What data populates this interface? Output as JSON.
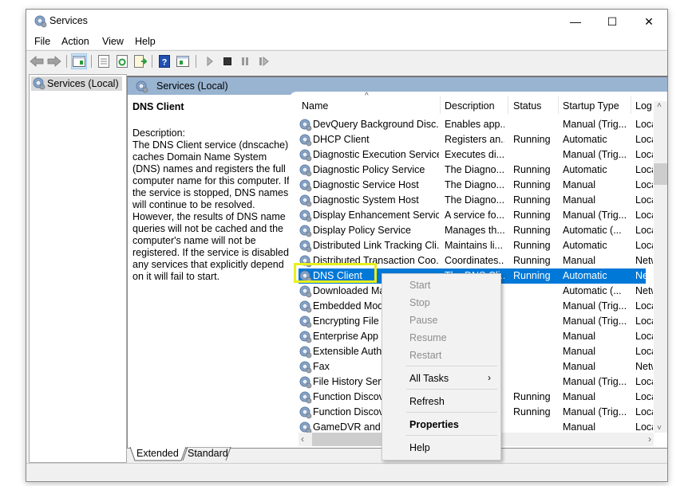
{
  "window": {
    "title": "Services",
    "controls": {
      "minimize": "—",
      "maximize": "☐",
      "close": "✕"
    }
  },
  "menubar": {
    "items": [
      "File",
      "Action",
      "View",
      "Help"
    ]
  },
  "toolbar": {
    "buttons": [
      "back-icon",
      "forward-icon",
      "show-hide-console-tree-icon",
      "properties-icon",
      "refresh-icon",
      "export-list-icon",
      "help-icon",
      "show-action-pane-icon",
      "start-service-icon",
      "stop-service-icon",
      "pause-service-icon",
      "restart-service-icon"
    ]
  },
  "tree": {
    "root": "Services (Local)"
  },
  "panel": {
    "header": "Services (Local)",
    "selected_service": {
      "name": "DNS Client",
      "description_label": "Description:",
      "description": "The DNS Client service (dnscache) caches Domain Name System (DNS) names and registers the full computer name for this computer. If the service is stopped, DNS names will continue to be resolved. However, the results of DNS name queries will not be cached and the computer's name will not be registered. If the service is disabled, any services that explicitly depend on it will fail to start."
    },
    "columns": [
      "Name",
      "Description",
      "Status",
      "Startup Type",
      "Log"
    ],
    "sort_indicator": "^",
    "rows": [
      {
        "name": "DevQuery Background Disc...",
        "description": "Enables app...",
        "status": "",
        "startup": "Manual (Trig...",
        "log": "Loca"
      },
      {
        "name": "DHCP Client",
        "description": "Registers an...",
        "status": "Running",
        "startup": "Automatic",
        "log": "Loca"
      },
      {
        "name": "Diagnostic Execution Service",
        "description": "Executes di...",
        "status": "",
        "startup": "Manual (Trig...",
        "log": "Loca"
      },
      {
        "name": "Diagnostic Policy Service",
        "description": "The Diagno...",
        "status": "Running",
        "startup": "Automatic",
        "log": "Loca"
      },
      {
        "name": "Diagnostic Service Host",
        "description": "The Diagno...",
        "status": "Running",
        "startup": "Manual",
        "log": "Loca"
      },
      {
        "name": "Diagnostic System Host",
        "description": "The Diagno...",
        "status": "Running",
        "startup": "Manual",
        "log": "Loca"
      },
      {
        "name": "Display Enhancement Service",
        "description": "A service fo...",
        "status": "Running",
        "startup": "Manual (Trig...",
        "log": "Loca"
      },
      {
        "name": "Display Policy Service",
        "description": "Manages th...",
        "status": "Running",
        "startup": "Automatic (...",
        "log": "Loca"
      },
      {
        "name": "Distributed Link Tracking Cli...",
        "description": "Maintains li...",
        "status": "Running",
        "startup": "Automatic",
        "log": "Loca"
      },
      {
        "name": "Distributed Transaction Coo...",
        "description": "Coordinates...",
        "status": "Running",
        "startup": "Manual",
        "log": "Netw"
      },
      {
        "name": "DNS Client",
        "description": "The DNS Cli...",
        "status": "Running",
        "startup": "Automatic",
        "log": "Netw",
        "selected": true
      },
      {
        "name": "Downloaded Maps Manager",
        "description": "",
        "status": "",
        "startup": "Automatic (...",
        "log": "Netw"
      },
      {
        "name": "Embedded Mode",
        "description": "",
        "status": "",
        "startup": "Manual (Trig...",
        "log": "Loca"
      },
      {
        "name": "Encrypting File System",
        "description": "",
        "status": "",
        "startup": "Manual (Trig...",
        "log": "Loca"
      },
      {
        "name": "Enterprise App Management",
        "description": "",
        "status": "",
        "startup": "Manual",
        "log": "Loca"
      },
      {
        "name": "Extensible Authentication",
        "description": "",
        "status": "",
        "startup": "Manual",
        "log": "Loca"
      },
      {
        "name": "Fax",
        "description": "",
        "status": "",
        "startup": "Manual",
        "log": "Netw"
      },
      {
        "name": "File History Service",
        "description": "",
        "status": "",
        "startup": "Manual (Trig...",
        "log": "Loca"
      },
      {
        "name": "Function Discovery Provider",
        "description": "",
        "status": "Running",
        "startup": "Manual",
        "log": "Loca"
      },
      {
        "name": "Function Discovery Resource",
        "description": "",
        "status": "Running",
        "startup": "Manual (Trig...",
        "log": "Loca"
      },
      {
        "name": "GameDVR and Broadcast",
        "description": "",
        "status": "",
        "startup": "Manual",
        "log": "Loca"
      }
    ]
  },
  "tabs": [
    "Extended",
    "Standard"
  ],
  "context_menu": {
    "items": [
      {
        "label": "Start",
        "disabled": true
      },
      {
        "label": "Stop",
        "disabled": true
      },
      {
        "label": "Pause",
        "disabled": true
      },
      {
        "label": "Resume",
        "disabled": true
      },
      {
        "label": "Restart",
        "disabled": true
      },
      {
        "label": "All Tasks",
        "submenu": true
      },
      {
        "label": "Refresh"
      },
      {
        "label": "Properties",
        "bold": true
      },
      {
        "label": "Help"
      }
    ],
    "submenu_arrow": "›"
  },
  "colors": {
    "selection": "#0078d7",
    "panel_header": "#99b4d1",
    "highlight_box": "#e8f01c"
  }
}
